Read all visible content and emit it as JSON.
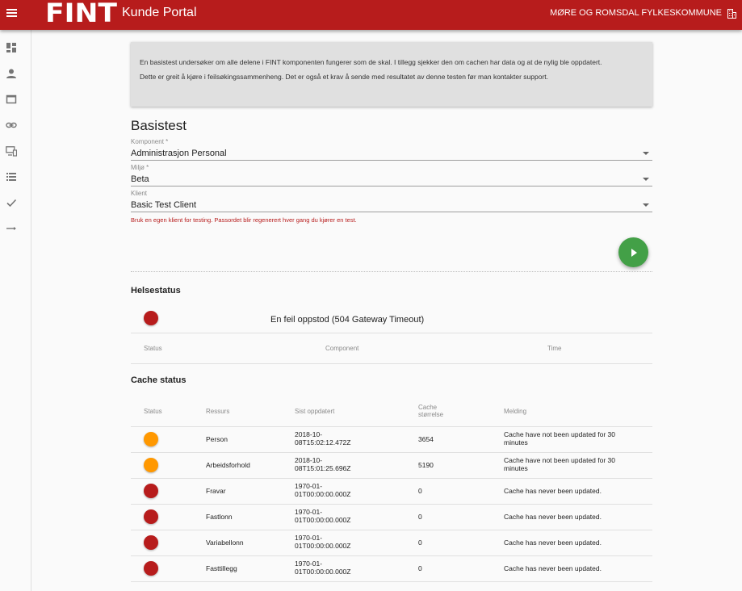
{
  "header": {
    "logo_text": "FINT",
    "app_title": "Kunde Portal",
    "organization": "MØRE OG ROMSDAL FYLKESKOMMUNE"
  },
  "sidebar": {
    "icons": [
      "dashboard-icon",
      "person-icon",
      "window-icon",
      "link-icon",
      "devices-icon",
      "list-icon",
      "check-icon",
      "arrow-right-icon"
    ]
  },
  "info": {
    "paragraph1": "En basistest undersøker om alle delene i FINT komponenten fungerer som de skal. I tillegg sjekker den om cachen har data og at de nylig ble oppdatert.",
    "paragraph2": "Dette er greit å kjøre i feilsøkingssammenheng. Det er også et krav å sende med resultatet av denne testen før man kontakter support."
  },
  "form": {
    "title": "Basistest",
    "komponent": {
      "label": "Komponent *",
      "value": "Administrasjon Personal"
    },
    "miljo": {
      "label": "Miljø *",
      "value": "Beta"
    },
    "klient": {
      "label": "Klient",
      "value": "Basic Test Client"
    },
    "hint": "Bruk en egen klient for testing. Passordet blir regenerert hver gang du kjører en test."
  },
  "health": {
    "title": "Helsestatus",
    "message": "En feil oppstod (504 Gateway Timeout)",
    "status_color": "#b71c1c",
    "columns": [
      "Status",
      "Component",
      "Time"
    ]
  },
  "cache": {
    "title": "Cache status",
    "columns": {
      "status": "Status",
      "ressurs": "Ressurs",
      "sist_oppdatert": "Sist oppdatert",
      "cache_storrelse_line1": "Cache",
      "cache_storrelse_line2": "størrelse",
      "melding": "Melding"
    },
    "rows": [
      {
        "status": "orange",
        "ressurs": "Person",
        "updated1": "2018-10-",
        "updated2": "08T15:02:12.472Z",
        "size": "3654",
        "msg1": "Cache have not been updated for 30",
        "msg2": "minutes"
      },
      {
        "status": "orange",
        "ressurs": "Arbeidsforhold",
        "updated1": "2018-10-",
        "updated2": "08T15:01:25.696Z",
        "size": "5190",
        "msg1": "Cache have not been updated for 30",
        "msg2": "minutes"
      },
      {
        "status": "red",
        "ressurs": "Fravar",
        "updated1": "1970-01-",
        "updated2": "01T00:00:00.000Z",
        "size": "0",
        "msg1": "Cache has never been updated.",
        "msg2": ""
      },
      {
        "status": "red",
        "ressurs": "Fastlonn",
        "updated1": "1970-01-",
        "updated2": "01T00:00:00.000Z",
        "size": "0",
        "msg1": "Cache has never been updated.",
        "msg2": ""
      },
      {
        "status": "red",
        "ressurs": "Variabellonn",
        "updated1": "1970-01-",
        "updated2": "01T00:00:00.000Z",
        "size": "0",
        "msg1": "Cache has never been updated.",
        "msg2": ""
      },
      {
        "status": "red",
        "ressurs": "Fasttillegg",
        "updated1": "1970-01-",
        "updated2": "01T00:00:00.000Z",
        "size": "0",
        "msg1": "Cache has never been updated.",
        "msg2": ""
      }
    ]
  },
  "colors": {
    "brand_red": "#b71c1c",
    "run_green": "#43a047",
    "warning_orange": "#ff9800"
  }
}
